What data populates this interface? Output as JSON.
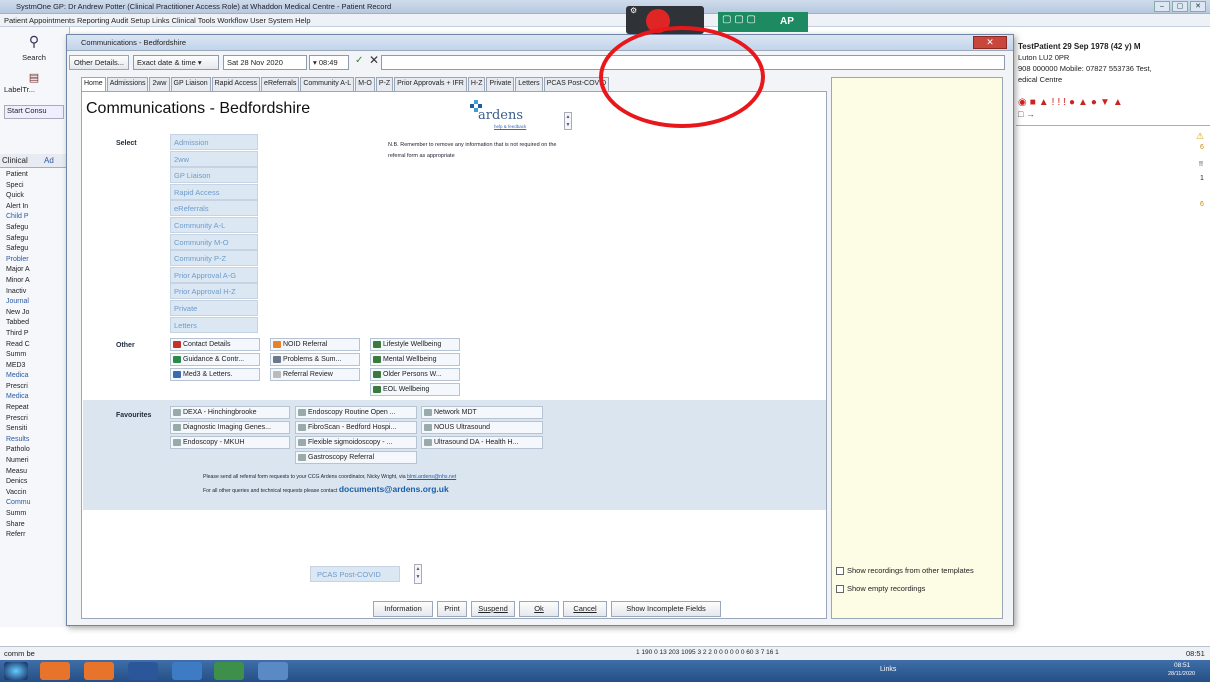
{
  "bg_window": {
    "title": "SystmOne GP: Dr Andrew Potter (Clinical Practitioner Access Role) at Whaddon Medical Centre - Patient Record",
    "menu": "Patient  Appointments  Reporting  Audit  Setup  Links  Clinical Tools  Workflow  User  System  Help",
    "controls": [
      "–",
      "▢",
      "✕"
    ]
  },
  "left_toolbar": {
    "search": "Search",
    "labeltr": "LabelTr...",
    "start_consult": "Start Consu",
    "tabs": [
      "Clinical",
      "Ad"
    ]
  },
  "left_tree": [
    "Patient",
    "Speci",
    "Quick",
    "Alert In",
    "Child P",
    "Safegu",
    "Safegu",
    "Safegu",
    "Probler",
    "Major A",
    "Minor A",
    "Inactiv",
    "Journal",
    "New Jo",
    "Tabbed",
    "Third P",
    "Read C",
    "Summ",
    "MED3",
    "Medica",
    "Prescri",
    "Medica",
    "Repeat",
    "Prescri",
    "Sensiti",
    "Results",
    "Patholo",
    "Numeri",
    "Measu",
    "Denics",
    "Vaccin",
    "Commu",
    "Summ",
    "Share",
    "Referr"
  ],
  "patient": {
    "name": "TestPatient 29 Sep 1978 (42 y) M",
    "address": "Luton LU2 0PR",
    "phone": "908 000000 Mobile: 07827 553736  Test,",
    "practice": "edical Centre"
  },
  "right_badges": [
    "6",
    "!!",
    "1",
    "6"
  ],
  "dialog": {
    "title": "Communications - Bedfordshire",
    "other_details": "Other Details...",
    "date_mode": "Exact date & time",
    "date": "Sat 28 Nov 2020",
    "time": "08:49",
    "tabs": [
      "Home",
      "Admissions",
      "2ww",
      "GP Liaison",
      "Rapid Access",
      "eReferrals",
      "Community A-L",
      "M-O",
      "P-Z",
      "Prior Approvals + IFR",
      "H-Z",
      "Private",
      "Letters",
      "PCAS Post-COVID"
    ],
    "heading": "Communications - Bedfordshire",
    "logo": {
      "name": "ardens",
      "sub": "help & feedback"
    },
    "select_label": "Select",
    "select_items": [
      "Admission",
      "2ww",
      "GP Liaison",
      "Rapid Access",
      "eReferrals",
      "Community A-L",
      "Community M-O",
      "Community P-Z",
      "Prior Approval A-G",
      "Prior Approval H-Z",
      "Private",
      "Letters"
    ],
    "note": "N.B. Remember to remove any information that is not required on the referral form as appropriate",
    "other_label": "Other",
    "other_col1": [
      "Contact Details",
      "Guidance & Contr...",
      "Med3 & Letters."
    ],
    "other_col2": [
      "NOID Referral",
      "Problems & Sum...",
      "Referral Review"
    ],
    "other_col3": [
      "Lifestyle Wellbeing",
      "Mental Wellbeing",
      "Older Persons W...",
      "EOL Wellbeing"
    ],
    "favourites_label": "Favourites",
    "fav_col1": [
      "DEXA - Hinchingbrooke",
      "Diagnostic Imaging Genes...",
      "Endoscopy - MKUH"
    ],
    "fav_col2": [
      "Endoscopy Routine Open ...",
      "FibroScan - Bedford Hospi...",
      "Flexible sigmoidoscopy - ...",
      "Gastroscopy Referral"
    ],
    "fav_col3": [
      "Network MDT",
      "NOUS Ultrasound",
      "Ultrasound DA - Health H..."
    ],
    "fav_note1": "Please send all referral form requests to your CCG Ardens coordinator, Nicky Wright, via",
    "fav_note1_link": "blmi.ardens@nhs.net",
    "fav_note2": "For all other queries and technical requests please contact",
    "fav_email": "documents@ardens.org.uk",
    "bottom_select": "PCAS Post-COVID",
    "right_checks": [
      "Show recordings from other templates",
      "Show empty recordings"
    ],
    "buttons": [
      "Information",
      "Print",
      "Suspend",
      "Ok",
      "Cancel",
      "Show Incomplete Fields"
    ]
  },
  "overlay_toolbar": {
    "ap": "AP"
  },
  "statusbar": {
    "text": "comm be",
    "counts": "1  190  0  13  203     1095  3     2   2  0  0     0  0  0  0     60  3     7  16  1",
    "time": "08:51"
  },
  "taskbar": {
    "links": "Links",
    "clock": "08:51",
    "date": "28/11/2020"
  }
}
